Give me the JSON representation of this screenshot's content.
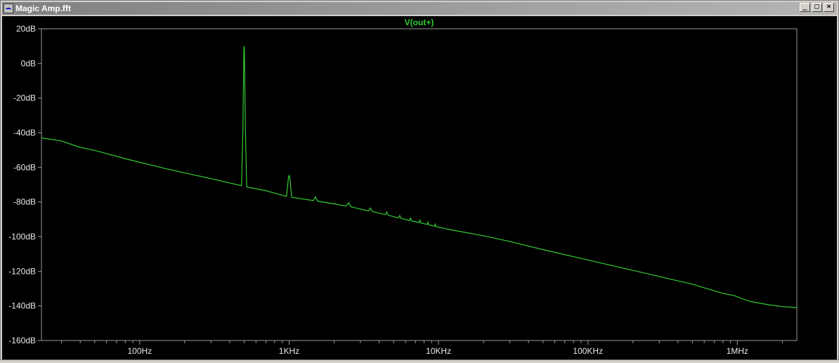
{
  "window": {
    "title": "Magic Amp.fft",
    "buttons": [
      "_",
      "□",
      "×"
    ]
  },
  "colors": {
    "trace": "#33cc33",
    "axis": "#9a9a9a",
    "label": "#e8e8e8",
    "background": "#000000"
  },
  "chart_data": {
    "type": "line",
    "title": "V(out+)",
    "xscale": "log",
    "xlim": [
      22,
      2500000
    ],
    "ylim": [
      -160,
      20
    ],
    "xticks": [
      {
        "value": 100,
        "label": "100Hz"
      },
      {
        "value": 1000,
        "label": "1KHz"
      },
      {
        "value": 10000,
        "label": "10KHz"
      },
      {
        "value": 100000,
        "label": "100KHz"
      },
      {
        "value": 1000000,
        "label": "1MHz"
      }
    ],
    "yticks": [
      {
        "value": 20,
        "label": "20dB"
      },
      {
        "value": 0,
        "label": "0dB"
      },
      {
        "value": -20,
        "label": "-20dB"
      },
      {
        "value": -40,
        "label": "-40dB"
      },
      {
        "value": -60,
        "label": "-60dB"
      },
      {
        "value": -80,
        "label": "-80dB"
      },
      {
        "value": -100,
        "label": "-100dB"
      },
      {
        "value": -120,
        "label": "-120dB"
      },
      {
        "value": -140,
        "label": "-140dB"
      },
      {
        "value": -160,
        "label": "-160dB"
      }
    ],
    "grid": false,
    "series": [
      {
        "name": "V(out+)",
        "points": [
          [
            22,
            -43.0
          ],
          [
            30,
            -44.8
          ],
          [
            40,
            -48.5
          ],
          [
            50,
            -50.2
          ],
          [
            80,
            -55.0
          ],
          [
            150,
            -60.8
          ],
          [
            300,
            -66.5
          ],
          [
            480,
            -70.6
          ],
          [
            490,
            -40
          ],
          [
            498,
            8
          ],
          [
            500,
            10
          ],
          [
            502,
            8
          ],
          [
            510,
            -40
          ],
          [
            520,
            -71.3
          ],
          [
            700,
            -73.5
          ],
          [
            960,
            -76.8
          ],
          [
            990,
            -66
          ],
          [
            1000,
            -64.5
          ],
          [
            1010,
            -66
          ],
          [
            1040,
            -77.3
          ],
          [
            1450,
            -79.2
          ],
          [
            1500,
            -77.0
          ],
          [
            1550,
            -79.5
          ],
          [
            2400,
            -82.3
          ],
          [
            2500,
            -80.5
          ],
          [
            2600,
            -82.8
          ],
          [
            3400,
            -85.2
          ],
          [
            3500,
            -83.5
          ],
          [
            3600,
            -85.5
          ],
          [
            4400,
            -87.3
          ],
          [
            4500,
            -85.8
          ],
          [
            4600,
            -87.6
          ],
          [
            5400,
            -89.2
          ],
          [
            5500,
            -87.8
          ],
          [
            5600,
            -89.4
          ],
          [
            6400,
            -90.7
          ],
          [
            6500,
            -89.2
          ],
          [
            6600,
            -90.9
          ],
          [
            7400,
            -91.9
          ],
          [
            7500,
            -90.5
          ],
          [
            7600,
            -92.1
          ],
          [
            8400,
            -93.0
          ],
          [
            8500,
            -91.7
          ],
          [
            8600,
            -93.2
          ],
          [
            9400,
            -94.0
          ],
          [
            9500,
            -92.8
          ],
          [
            9600,
            -94.2
          ],
          [
            12000,
            -96.0
          ],
          [
            20000,
            -99.5
          ],
          [
            30000,
            -102.8
          ],
          [
            50000,
            -107.5
          ],
          [
            100000,
            -113.5
          ],
          [
            200000,
            -119.5
          ],
          [
            500000,
            -127.5
          ],
          [
            800000,
            -132.8
          ],
          [
            950000,
            -134.0
          ],
          [
            1200000,
            -137.3
          ],
          [
            1600000,
            -139.3
          ],
          [
            2000000,
            -140.4
          ],
          [
            2500000,
            -141.0
          ]
        ]
      }
    ]
  }
}
